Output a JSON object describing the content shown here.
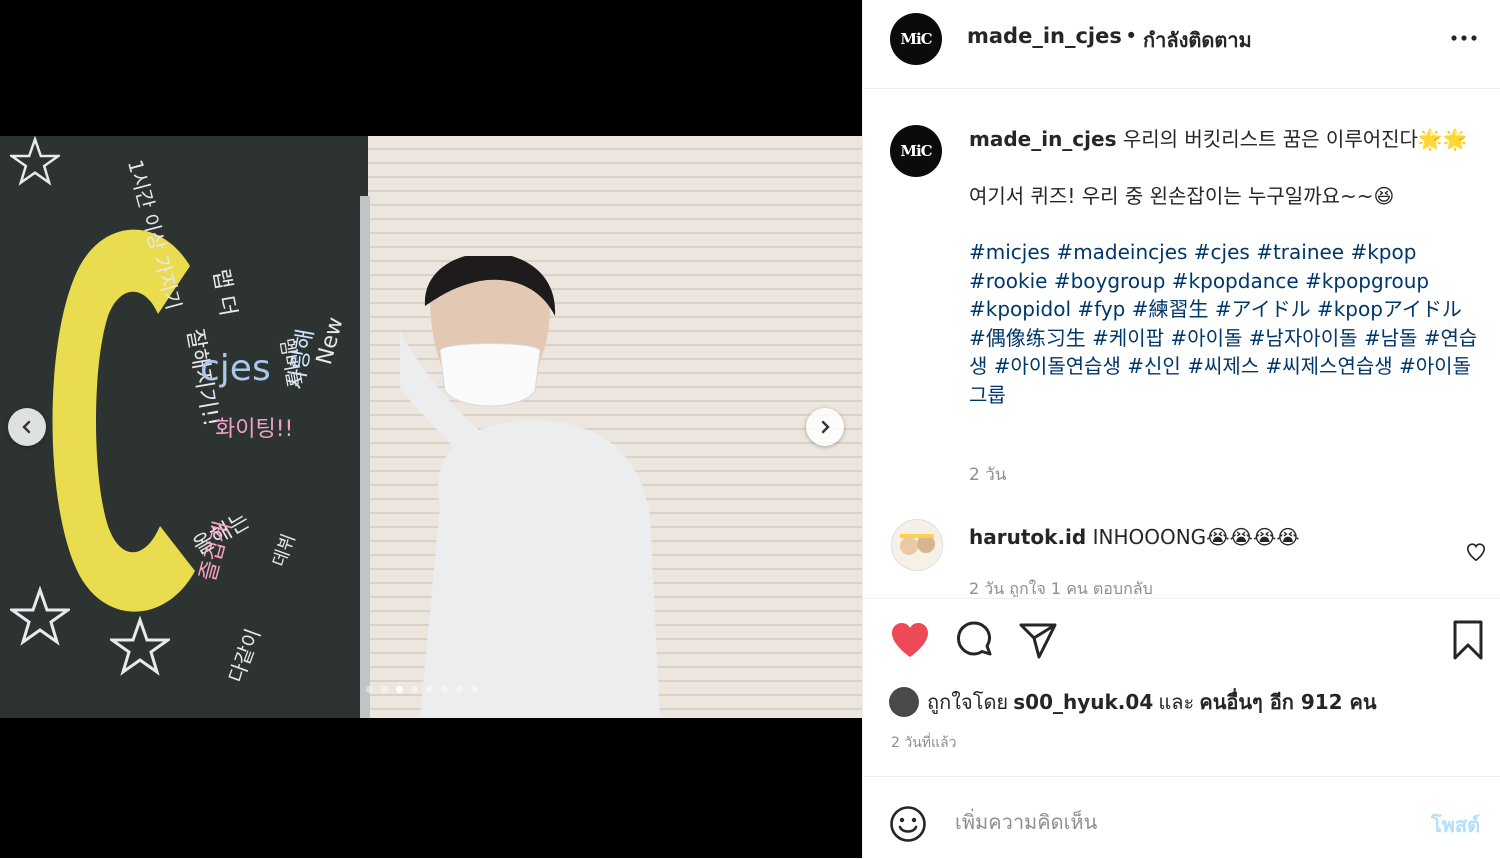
{
  "post": {
    "username": "made_in_cjes",
    "separator": "•",
    "follow_status": "กำลังติดตาม",
    "avatar_text": "MiC"
  },
  "media": {
    "board_letter": "C",
    "board_words": [
      "1시간 이상 가지기",
      "랩 더",
      "잘해지기!!",
      "cjes",
      "화이팅!!",
      "멤버들",
      "사랑해",
      "New",
      "올해는",
      "즐겁게",
      "데뷔",
      "다같이"
    ],
    "dots_total": 8,
    "dots_active": 3
  },
  "caption": {
    "username": "made_in_cjes",
    "line1": "우리의 버킷리스트 꿈은 이루어진다🌟🌟",
    "line2": "여기서 퀴즈! 우리 중 왼손잡이는 누구일까요~~😆",
    "hashtags": "#micjes #madeincjes #cjes #trainee #kpop #rookie #boygroup #kpopdance #kpopgroup #kpopidol #fyp #練習生 #アイドル #kpopアイドル #偶像练习生 #케이팝 #아이돌 #남자아이돌 #남돌 #연습생 #아이돌연습생 #신인 #씨제스 #씨제스연습생 #아이돌그룹",
    "time": "2 วัน"
  },
  "comment": {
    "username": "harutok.id",
    "text": "INHOOONG😭😭😭😭",
    "meta": "2 วัน   ถูกใจ 1 คน   ตอบกลับ"
  },
  "likes": {
    "prefix": "ถูกใจโดย",
    "user": "s00_hyuk.04",
    "mid": "และ",
    "others": "คนอื่นๆ อีก 912 คน"
  },
  "posted_ago": "2 วันที่แล้ว",
  "add_comment": {
    "placeholder": "เพิ่มความคิดเห็น",
    "post_label": "โพสต์"
  },
  "colors": {
    "heart": "#ed4956",
    "hashtag": "#00376b",
    "post_disabled": "#b2dffc",
    "board": "#2c3331",
    "c_yellow": "#e9dc4e"
  }
}
